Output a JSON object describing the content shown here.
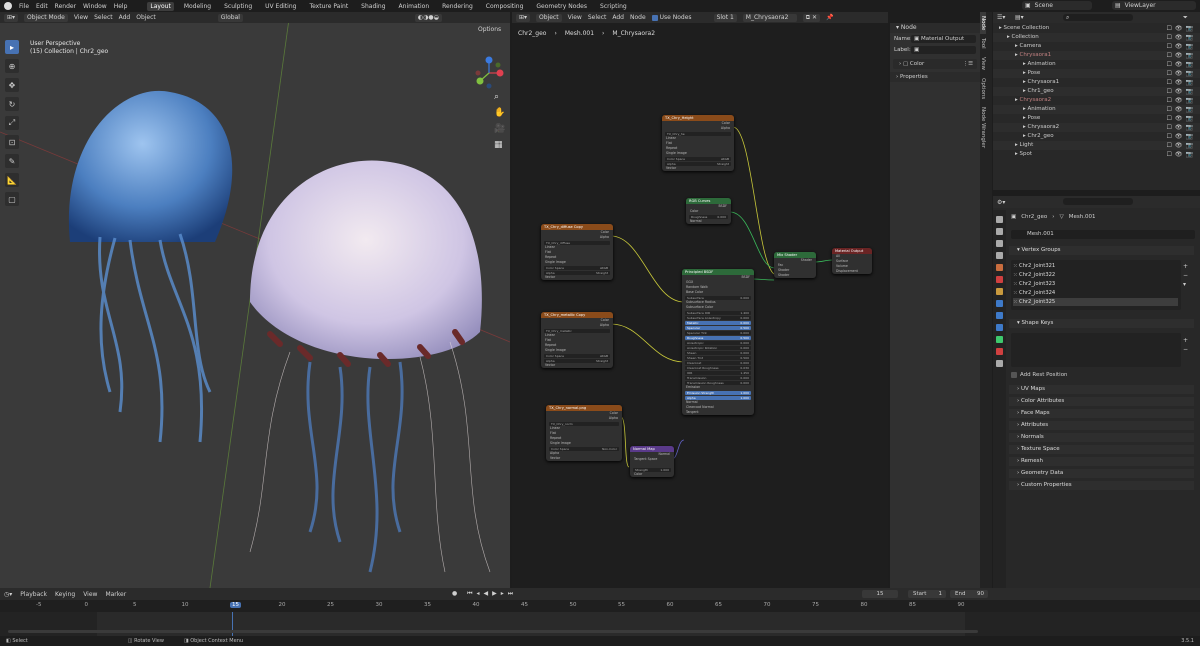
{
  "menu": [
    "File",
    "Edit",
    "Render",
    "Window",
    "Help"
  ],
  "workspaces": [
    "Layout",
    "Modeling",
    "Sculpting",
    "UV Editing",
    "Texture Paint",
    "Shading",
    "Animation",
    "Rendering",
    "Compositing",
    "Geometry Nodes",
    "Scripting"
  ],
  "active_workspace": "Layout",
  "scene": "Scene",
  "view_layer": "ViewLayer",
  "viewport": {
    "mode": "Object Mode",
    "menus": [
      "View",
      "Select",
      "Add",
      "Object"
    ],
    "orientation": "Global",
    "info_line1": "User Perspective",
    "info_line2": "(15) Collection | Chr2_geo",
    "options": "Options"
  },
  "node_editor": {
    "type": "Object",
    "menus": [
      "View",
      "Select",
      "Add",
      "Node"
    ],
    "use_nodes": "Use Nodes",
    "slot": "Slot 1",
    "material": "M_Chrysaora2",
    "breadcrumb": [
      "Chr2_geo",
      "Mesh.001",
      "M_Chrysaora2"
    ],
    "nodes": {
      "top_tex": {
        "title": "TX_Chry_Height",
        "image": "TX_Chry_he",
        "rows": [
          "Linear",
          "Flat",
          "Repeat",
          "Single Image",
          "Color Space",
          "Alpha",
          "Vector"
        ],
        "vals": [
          "",
          "",
          "",
          "",
          "sRGB",
          "Straight",
          ""
        ],
        "outs": [
          "Color",
          "Alpha"
        ]
      },
      "rgb": {
        "title": "RGB Curves",
        "rows": [
          "Color",
          "Roughness",
          "Normal"
        ],
        "vals": [
          "",
          "0.000",
          ""
        ],
        "outs": [
          "BSDF"
        ]
      },
      "tex2": {
        "title": "TX_Chry_diffuse Copy",
        "image": "TX_Chry_diffuse",
        "rows": [
          "Linear",
          "Flat",
          "Repeat",
          "Single Image",
          "Color Space",
          "Alpha",
          "Vector"
        ],
        "vals": [
          "",
          "",
          "",
          "",
          "sRGB",
          "Straight",
          ""
        ],
        "outs": [
          "Color",
          "Alpha"
        ]
      },
      "tex3": {
        "title": "TX_Chry_metallic Copy",
        "image": "TX_Chry_metallic",
        "rows": [
          "Linear",
          "Flat",
          "Repeat",
          "Single Image",
          "Color Space",
          "Alpha",
          "Vector"
        ],
        "vals": [
          "",
          "",
          "",
          "",
          "sRGB",
          "Straight",
          ""
        ],
        "outs": [
          "Color",
          "Alpha"
        ]
      },
      "tex4": {
        "title": "TX_Chry_normal.png",
        "image": "TX_Chry_norm",
        "rows": [
          "Linear",
          "Flat",
          "Repeat",
          "Single Image",
          "Color Space",
          "Alpha",
          "Vector"
        ],
        "vals": [
          "",
          "",
          "",
          "",
          "Non-Color",
          "",
          ""
        ],
        "outs": [
          "Color",
          "Alpha"
        ]
      },
      "normalmap": {
        "title": "Normal Map",
        "rows": [
          "Tangent Space",
          "",
          "Strength",
          "Color"
        ],
        "vals": [
          "",
          "",
          "1.000",
          ""
        ],
        "outs": [
          "Normal"
        ]
      },
      "bsdf": {
        "title": "Principled BSDF",
        "outs": [
          "BSDF"
        ],
        "rows": [
          "GGX",
          "Random Walk",
          "Base Color",
          "Subsurface",
          "Subsurface Radius",
          "Subsurface Color",
          "Subsurface IOR",
          "Subsurface Anisotropy",
          "Metallic",
          "Specular",
          "Specular Tint",
          "Roughness",
          "Anisotropic",
          "Anisotropic Rotation",
          "Sheen",
          "Sheen Tint",
          "Clearcoat",
          "Clearcoat Roughness",
          "IOR",
          "Transmission",
          "Transmission Roughness",
          "Emission",
          "Emission Strength",
          "Alpha",
          "Normal",
          "Clearcoat Normal",
          "Tangent"
        ],
        "vals": [
          "",
          "",
          "",
          "0.000",
          "",
          "",
          "1.400",
          "0.000",
          "0.000",
          "0.500",
          "0.000",
          "0.500",
          "0.000",
          "0.000",
          "0.000",
          "0.500",
          "0.000",
          "0.030",
          "1.450",
          "0.000",
          "0.000",
          "",
          "1.000",
          "1.000",
          "",
          "",
          ""
        ]
      },
      "mixshader": {
        "title": "Mix Shader",
        "rows": [
          "Fac",
          "Shader",
          "Shader"
        ],
        "outs": [
          "Shader"
        ]
      },
      "output": {
        "title": "Material Output",
        "rows": [
          "All",
          "Surface",
          "Volume",
          "Displacement"
        ]
      }
    }
  },
  "n_panel": {
    "section": "Node",
    "name_label": "Name:",
    "name_value": "Material Output",
    "label_label": "Label:",
    "color": "Color",
    "properties": "Properties",
    "tabs": [
      "Node",
      "Tool",
      "View",
      "Options",
      "Node Wrangler"
    ]
  },
  "outliner": {
    "rows": [
      {
        "label": "Scene Collection",
        "indent": 0,
        "color": "#ccc"
      },
      {
        "label": "Collection",
        "indent": 1,
        "color": "#ccc"
      },
      {
        "label": "Camera",
        "indent": 2,
        "color": "#ccc"
      },
      {
        "label": "Chrysaora1",
        "indent": 2,
        "color": "#c08080"
      },
      {
        "label": "Animation",
        "indent": 3,
        "color": "#ccc"
      },
      {
        "label": "Pose",
        "indent": 3,
        "color": "#ccc"
      },
      {
        "label": "Chrysaora1",
        "indent": 3,
        "color": "#ccc"
      },
      {
        "label": "Chr1_geo",
        "indent": 3,
        "color": "#ccc"
      },
      {
        "label": "Chrysaora2",
        "indent": 2,
        "color": "#c08080"
      },
      {
        "label": "Animation",
        "indent": 3,
        "color": "#ccc"
      },
      {
        "label": "Pose",
        "indent": 3,
        "color": "#ccc"
      },
      {
        "label": "Chrysaora2",
        "indent": 3,
        "color": "#ccc"
      },
      {
        "label": "Chr2_geo",
        "indent": 3,
        "color": "#ccc"
      },
      {
        "label": "Light",
        "indent": 2,
        "color": "#ccc"
      },
      {
        "label": "Spot",
        "indent": 2,
        "color": "#ccc"
      }
    ]
  },
  "properties": {
    "object": "Chr2_geo",
    "mesh": "Mesh.001",
    "mesh_field": "Mesh.001",
    "vertex_groups_title": "Vertex Groups",
    "vertex_groups": [
      "Chr2_joint321",
      "Chr2_joint322",
      "Chr2_joint323",
      "Chr2_joint324",
      "Chr2_joint325"
    ],
    "shape_keys_title": "Shape Keys",
    "add_rest": "Add Rest Position",
    "sections": [
      "UV Maps",
      "Color Attributes",
      "Face Maps",
      "Attributes",
      "Normals",
      "Texture Space",
      "Remesh",
      "Geometry Data",
      "Custom Properties"
    ]
  },
  "timeline": {
    "menus": [
      "Playback",
      "Keying",
      "View",
      "Marker"
    ],
    "current_frame": "15",
    "start_label": "Start",
    "start": "1",
    "end_label": "End",
    "end": "90",
    "ticks": [
      "-5",
      "0",
      "5",
      "10",
      "15",
      "20",
      "25",
      "30",
      "35",
      "40",
      "45",
      "50",
      "55",
      "60",
      "65",
      "70",
      "75",
      "80",
      "85",
      "90"
    ]
  },
  "status": {
    "select": "Select",
    "rotate": "Rotate View",
    "context": "Object Context Menu",
    "version": "3.5.1"
  }
}
